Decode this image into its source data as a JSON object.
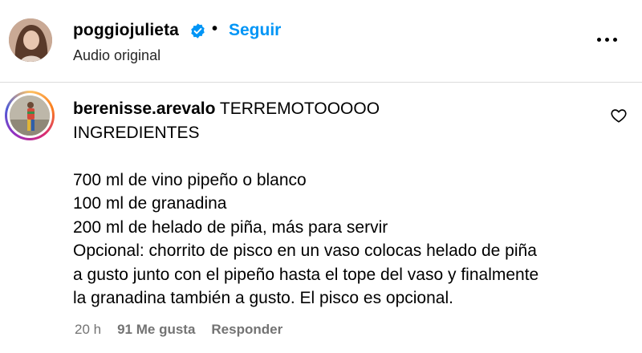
{
  "post_header": {
    "username": "poggiojulieta",
    "separator": "•",
    "follow_label": "Seguir",
    "subtitle": "Audio original",
    "verified_color": "#0095f6"
  },
  "comment": {
    "author": "berenisse.arevalo",
    "lines": [
      "TERREMOTOOOOO",
      "INGREDIENTES",
      "",
      "700 ml de vino pipeño o blanco",
      "100 ml de granadina",
      "200 ml de helado de piña, más para servir",
      "Opcional: chorrito de pisco en un vaso colocas helado de piña",
      "a gusto junto con el pipeño hasta el tope del vaso y finalmente",
      "la granadina también a gusto. El pisco es opcional."
    ],
    "time": "20 h",
    "likes": "91 Me gusta",
    "reply_label": "Responder"
  },
  "icons": {
    "verified": "verified-badge-icon",
    "more": "more-options-icon",
    "like": "heart-icon"
  },
  "colors": {
    "link": "#0095f6",
    "secondary_text": "#737373",
    "divider": "#dbdbdb"
  }
}
